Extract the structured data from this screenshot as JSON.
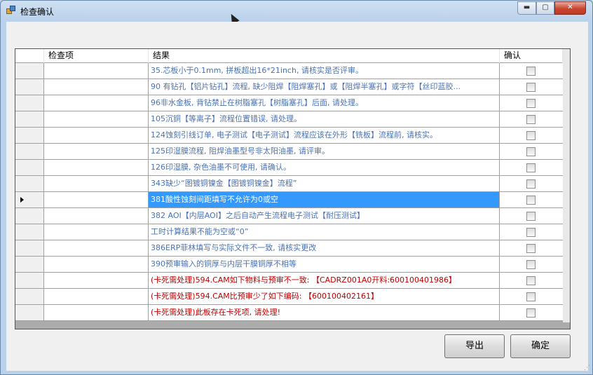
{
  "window": {
    "title": "检查确认",
    "min_glyph": "▬",
    "max_glyph": "▢",
    "close_glyph": "✕"
  },
  "grid": {
    "columns": [
      "检查项",
      "结果",
      "确认"
    ],
    "selected_row": 8,
    "rows": [
      {
        "item": "",
        "result": "35.芯板小于0.1mm, 拼板超出16*21inch, 请核实是否评审。",
        "confirmed": false,
        "style": "normal"
      },
      {
        "item": "",
        "result": "90 有钻孔【铝片钻孔】流程, 缺少阻焊【阻焊塞孔】或【阻焊半塞孔】或字符【丝印蓝胶...",
        "confirmed": false,
        "style": "normal"
      },
      {
        "item": "",
        "result": "96非水金板, 背钻禁止在树脂塞孔【树脂塞孔】后面, 请处理。",
        "confirmed": false,
        "style": "normal"
      },
      {
        "item": "",
        "result": "105沉铜【等离子】流程位置错误, 请处理。",
        "confirmed": false,
        "style": "normal"
      },
      {
        "item": "",
        "result": "124蚀刻引线订单, 电子测试【电子测试】流程应该在外形【铣板】流程前, 请核实。",
        "confirmed": false,
        "style": "normal"
      },
      {
        "item": "",
        "result": "125印湿膜流程, 阻焊油墨型号非太阳油墨, 请评审。",
        "confirmed": false,
        "style": "normal"
      },
      {
        "item": "",
        "result": "126印湿膜, 杂色油墨不可使用, 请确认。",
        "confirmed": false,
        "style": "normal"
      },
      {
        "item": "",
        "result": "343缺少“图镀铜镍金【图镀铜镍金】流程”",
        "confirmed": false,
        "style": "normal"
      },
      {
        "item": "",
        "result": "381酸性蚀刻间距填写不允许为0或空",
        "confirmed": false,
        "style": "selected"
      },
      {
        "item": "",
        "result": "382 AOI【内层AOI】之后自动产生流程电子测试【耐压测试】",
        "confirmed": false,
        "style": "normal"
      },
      {
        "item": "",
        "result": "工时计算结果不能为空或“0”",
        "confirmed": false,
        "style": "normal"
      },
      {
        "item": "",
        "result": "386ERP菲林填写与实际文件不一致, 请核实更改",
        "confirmed": false,
        "style": "normal"
      },
      {
        "item": "",
        "result": "390预审输入的铜厚与内层干膜铜厚不相等",
        "confirmed": false,
        "style": "normal"
      },
      {
        "item": "",
        "result": "(卡死需处理)594.CAM如下物料与预审不一致: 【CADRZ001A0开料:600100401986】",
        "confirmed": false,
        "style": "red"
      },
      {
        "item": "",
        "result": "(卡死需处理)594.CAM比预审少了如下编码: 【600100402161】",
        "confirmed": false,
        "style": "red"
      },
      {
        "item": "",
        "result": "(卡死需处理)此板存在卡死项, 请处理!",
        "confirmed": false,
        "style": "red"
      }
    ]
  },
  "buttons": {
    "export_label": "导出",
    "ok_label": "确定"
  },
  "colors": {
    "result_text": "#4a72b5",
    "blocking_text": "#c00000",
    "selection": "#3399ff"
  }
}
